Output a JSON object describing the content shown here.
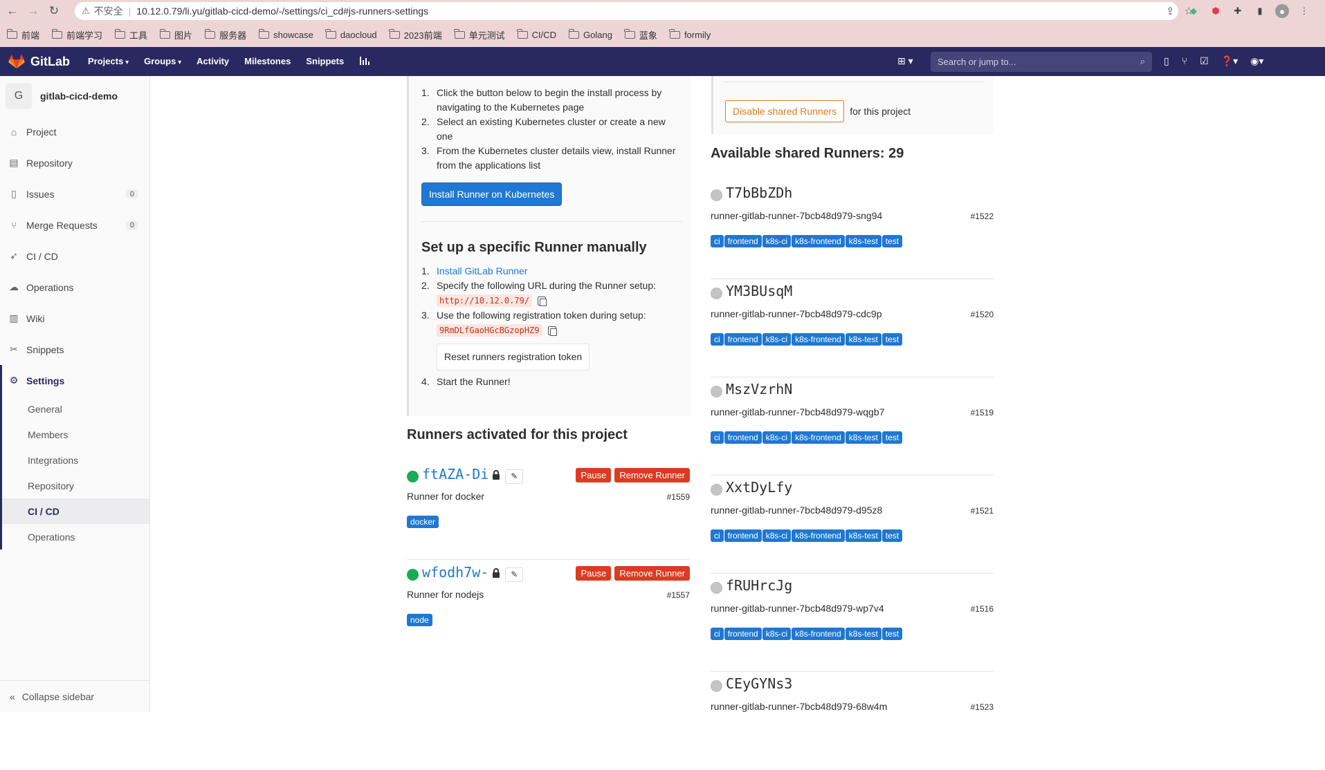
{
  "browser": {
    "insecure_label": "不安全",
    "url": "10.12.0.79/li.yu/gitlab-cicd-demo/-/settings/ci_cd#js-runners-settings",
    "bookmarks": [
      "前端",
      "前端学习",
      "工具",
      "图片",
      "服务器",
      "showcase",
      "daocloud",
      "2023前端",
      "单元测试",
      "CI/CD",
      "Golang",
      "蓝象",
      "formily"
    ]
  },
  "header": {
    "brand": "GitLab",
    "nav": [
      "Projects",
      "Groups",
      "Activity",
      "Milestones",
      "Snippets"
    ],
    "search_placeholder": "Search or jump to..."
  },
  "sidebar": {
    "avatar_letter": "G",
    "project_name": "gitlab-cicd-demo",
    "items": [
      {
        "label": "Project",
        "icon": "home-icon"
      },
      {
        "label": "Repository",
        "icon": "repository-icon"
      },
      {
        "label": "Issues",
        "icon": "issues-icon",
        "count": "0"
      },
      {
        "label": "Merge Requests",
        "icon": "merge-request-icon",
        "count": "0"
      },
      {
        "label": "CI / CD",
        "icon": "rocket-icon"
      },
      {
        "label": "Operations",
        "icon": "cloud-icon"
      },
      {
        "label": "Wiki",
        "icon": "book-icon"
      },
      {
        "label": "Snippets",
        "icon": "scissors-icon"
      },
      {
        "label": "Settings",
        "icon": "gear-icon"
      }
    ],
    "settings_sub": [
      "General",
      "Members",
      "Integrations",
      "Repository",
      "CI / CD",
      "Operations"
    ],
    "collapse_label": "Collapse sidebar"
  },
  "k8s_steps": [
    "Click the button below to begin the install process by navigating to the Kubernetes page",
    "Select an existing Kubernetes cluster or create a new one",
    "From the Kubernetes cluster details view, install Runner from the applications list"
  ],
  "install_k8s_button": "Install Runner on Kubernetes",
  "manual": {
    "heading": "Set up a specific Runner manually",
    "step1_link": "Install GitLab Runner",
    "step2": "Specify the following URL during the Runner setup:",
    "url": "http://10.12.0.79/",
    "step3": "Use the following registration token during setup:",
    "token": "9RmDLfGaoHGcBGzopHZ9",
    "reset_button": "Reset runners registration token",
    "step4": "Start the Runner!"
  },
  "activated": {
    "heading": "Runners activated for this project",
    "pause_label": "Pause",
    "remove_label": "Remove Runner",
    "runners": [
      {
        "name": "ftAZA-Di",
        "desc": "Runner for docker",
        "id": "#1559",
        "tags": [
          "docker"
        ]
      },
      {
        "name": "wfodh7w-",
        "desc": "Runner for nodejs",
        "id": "#1557",
        "tags": [
          "node"
        ]
      }
    ]
  },
  "shared": {
    "disable_button": "Disable shared Runners",
    "disable_suffix": "for this project",
    "heading": "Available shared Runners: 29",
    "runners": [
      {
        "name": "T7bBbZDh",
        "desc": "runner-gitlab-runner-7bcb48d979-sng94",
        "id": "#1522",
        "tags": [
          "ci",
          "frontend",
          "k8s-ci",
          "k8s-frontend",
          "k8s-test",
          "test"
        ]
      },
      {
        "name": "YM3BUsqM",
        "desc": "runner-gitlab-runner-7bcb48d979-cdc9p",
        "id": "#1520",
        "tags": [
          "ci",
          "frontend",
          "k8s-ci",
          "k8s-frontend",
          "k8s-test",
          "test"
        ]
      },
      {
        "name": "MszVzrhN",
        "desc": "runner-gitlab-runner-7bcb48d979-wqgb7",
        "id": "#1519",
        "tags": [
          "ci",
          "frontend",
          "k8s-ci",
          "k8s-frontend",
          "k8s-test",
          "test"
        ]
      },
      {
        "name": "XxtDyLfy",
        "desc": "runner-gitlab-runner-7bcb48d979-d95z8",
        "id": "#1521",
        "tags": [
          "ci",
          "frontend",
          "k8s-ci",
          "k8s-frontend",
          "k8s-test",
          "test"
        ]
      },
      {
        "name": "fRUHrcJg",
        "desc": "runner-gitlab-runner-7bcb48d979-wp7v4",
        "id": "#1516",
        "tags": [
          "ci",
          "frontend",
          "k8s-ci",
          "k8s-frontend",
          "k8s-test",
          "test"
        ]
      },
      {
        "name": "CEyGYNs3",
        "desc": "runner-gitlab-runner-7bcb48d979-68w4m",
        "id": "#1523",
        "tags": []
      }
    ]
  }
}
